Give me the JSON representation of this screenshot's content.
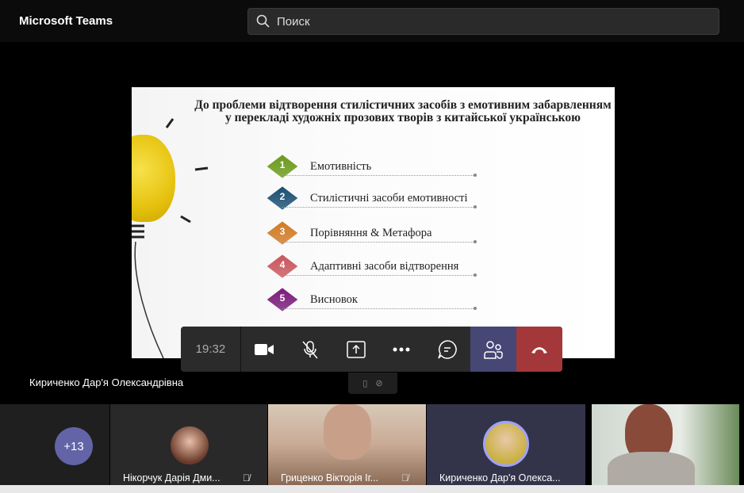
{
  "app": {
    "title": "Microsoft Teams",
    "search_placeholder": "Поиск"
  },
  "slide": {
    "title": "До проблеми відтворення стилістичних засобів з емотивним забарвленням у перекладі художніх прозових творів з китайської українською",
    "items": [
      {
        "num": "1",
        "label": "Емотивність",
        "color": "#6a9a1a"
      },
      {
        "num": "2",
        "label": "Стилістичні засоби емотивності",
        "color": "#1a4f73"
      },
      {
        "num": "3",
        "label": "Порівняння & Метафора",
        "color": "#d07a24"
      },
      {
        "num": "4",
        "label": "Адаптивні засоби відтворення",
        "color": "#c8565c"
      },
      {
        "num": "5",
        "label": "Висновок",
        "color": "#7a1a7a"
      }
    ]
  },
  "toolbar": {
    "time": "19:32"
  },
  "presenter": "Кириченко Дар'я Олександрівна",
  "participants": {
    "overflow": "+13",
    "tiles": [
      {
        "name": "Нікорчук Дарія Дми..."
      },
      {
        "name": "Гриценко Вікторія Іг..."
      },
      {
        "name": "Кириченко Дар'я Олекса..."
      }
    ]
  },
  "colors": {
    "accent": "#464775",
    "hangup": "#a4373a"
  }
}
